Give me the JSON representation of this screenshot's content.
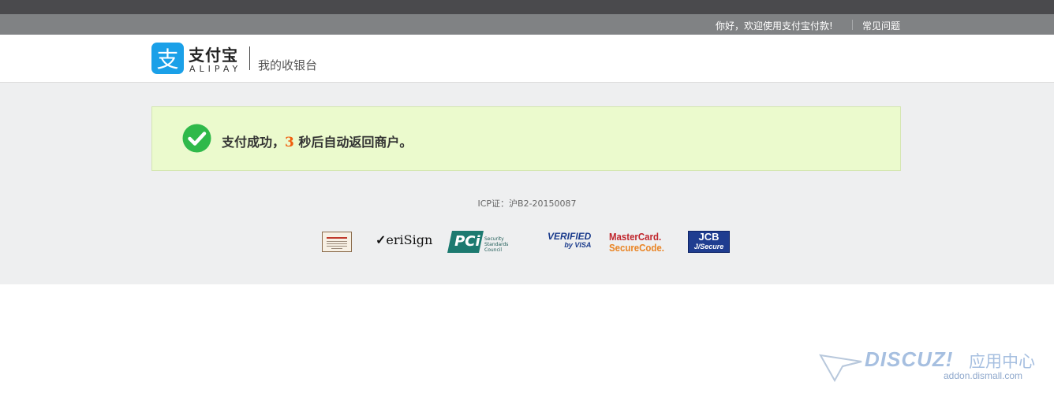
{
  "topbar": {
    "greeting": "你好，欢迎使用支付宝付款!",
    "faq_label": "常见问题"
  },
  "header": {
    "logo_cn": "支付宝",
    "logo_en": "ALIPAY",
    "subtitle": "我的收银台"
  },
  "success": {
    "prefix": "支付成功，",
    "countdown": "3",
    "suffix": " 秒后自动返回商户。"
  },
  "footer": {
    "icp": "ICP证：沪B2-20150087"
  },
  "badges": {
    "verisign": "eriSign",
    "pci_main": "PCi",
    "pci_small": "Security Standards Council",
    "vbv_line1": "VERIFIED",
    "vbv_line2": "by VISA",
    "mc_line1": "MasterCard.",
    "mc_line2": "SecureCode.",
    "jcb_line1": "JCB",
    "jcb_line2": "J/Secure"
  },
  "watermark": {
    "brand": "DISCUZ!",
    "cn": "应用中心",
    "url": "addon.dismall.com"
  },
  "colors": {
    "alipay_blue": "#1aa0e8",
    "success_green": "#2fb94a",
    "countdown_orange": "#f05e0d",
    "success_bg": "#ebfacd"
  }
}
